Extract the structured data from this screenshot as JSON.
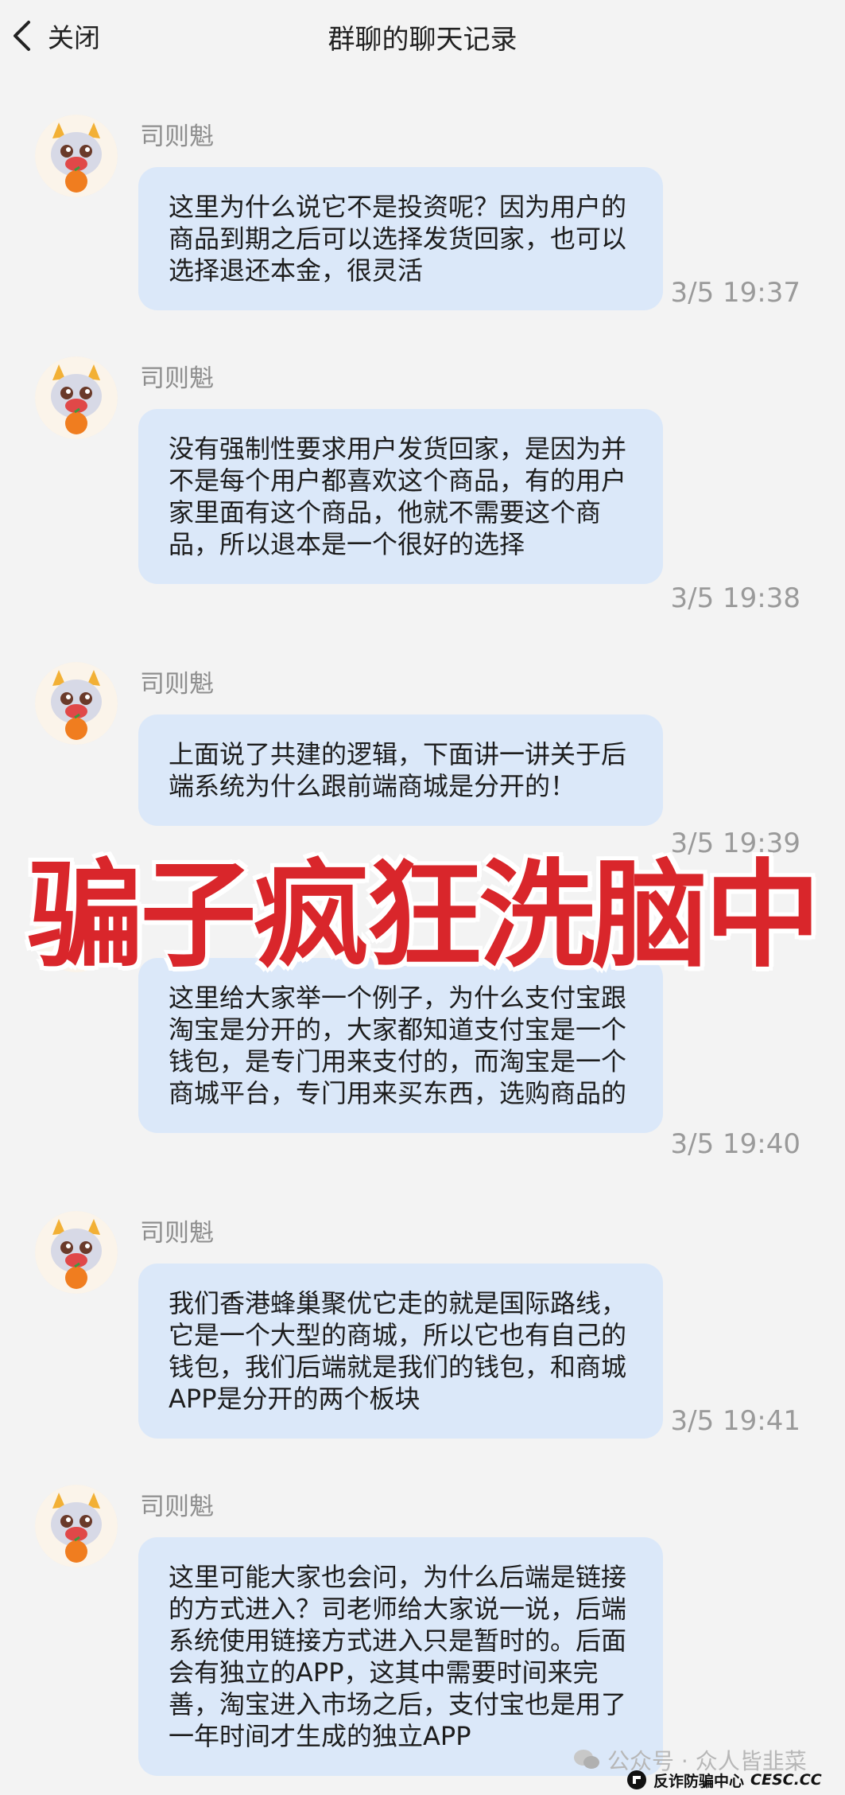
{
  "header": {
    "back_label": "关闭",
    "title": "群聊的聊天记录"
  },
  "messages": [
    {
      "sender": "司则魁",
      "text": "这里为什么说它不是投资呢？因为用户的商品到期之后可以选择发货回家，也可以选择退还本金，很灵活",
      "time": "3/5 19:37"
    },
    {
      "sender": "司则魁",
      "text": "没有强制性要求用户发货回家，是因为并不是每个用户都喜欢这个商品，有的用户家里面有这个商品，他就不需要这个商品，所以退本是一个很好的选择",
      "time": "3/5 19:38"
    },
    {
      "sender": "司则魁",
      "text": "上面说了共建的逻辑，下面讲一讲关于后端系统为什么跟前端商城是分开的！",
      "time": "3/5 19:39"
    },
    {
      "sender": "",
      "text": "这里给大家举一个例子，为什么支付宝跟淘宝是分开的，大家都知道支付宝是一个钱包，是专门用来支付的，而淘宝是一个商城平台，专门用来买东西，选购商品的",
      "time": "3/5 19:40"
    },
    {
      "sender": "司则魁",
      "text": "我们香港蜂巢聚优它走的就是国际路线，它是一个大型的商城，所以它也有自己的钱包，我们后端就是我们的钱包，和商城APP是分开的两个板块",
      "time": "3/5 19:41"
    },
    {
      "sender": "司则魁",
      "text": "这里可能大家也会问，为什么后端是链接的方式进入？司老师给大家说一说，后端系统使用链接方式进入只是暂时的。后面会有独立的APP，这其中需要时间来完善，淘宝进入市场之后，支付宝也是用了一年时间才生成的独立APP",
      "time": ""
    }
  ],
  "overlay_text": "骗子疯狂洗脑中",
  "watermark": {
    "text": "公众号 · 众人皆韭菜",
    "brand_cn": "反诈防骗中心",
    "brand_en": "CESC.CC"
  },
  "colors": {
    "bubble": "#dbe8f9",
    "overlay": "#d9262b",
    "background": "#f3f3f3"
  },
  "icons": {
    "back": "chevron-left-icon",
    "avatar": "dragon-mascot-avatar",
    "wechat": "wechat-icon"
  }
}
